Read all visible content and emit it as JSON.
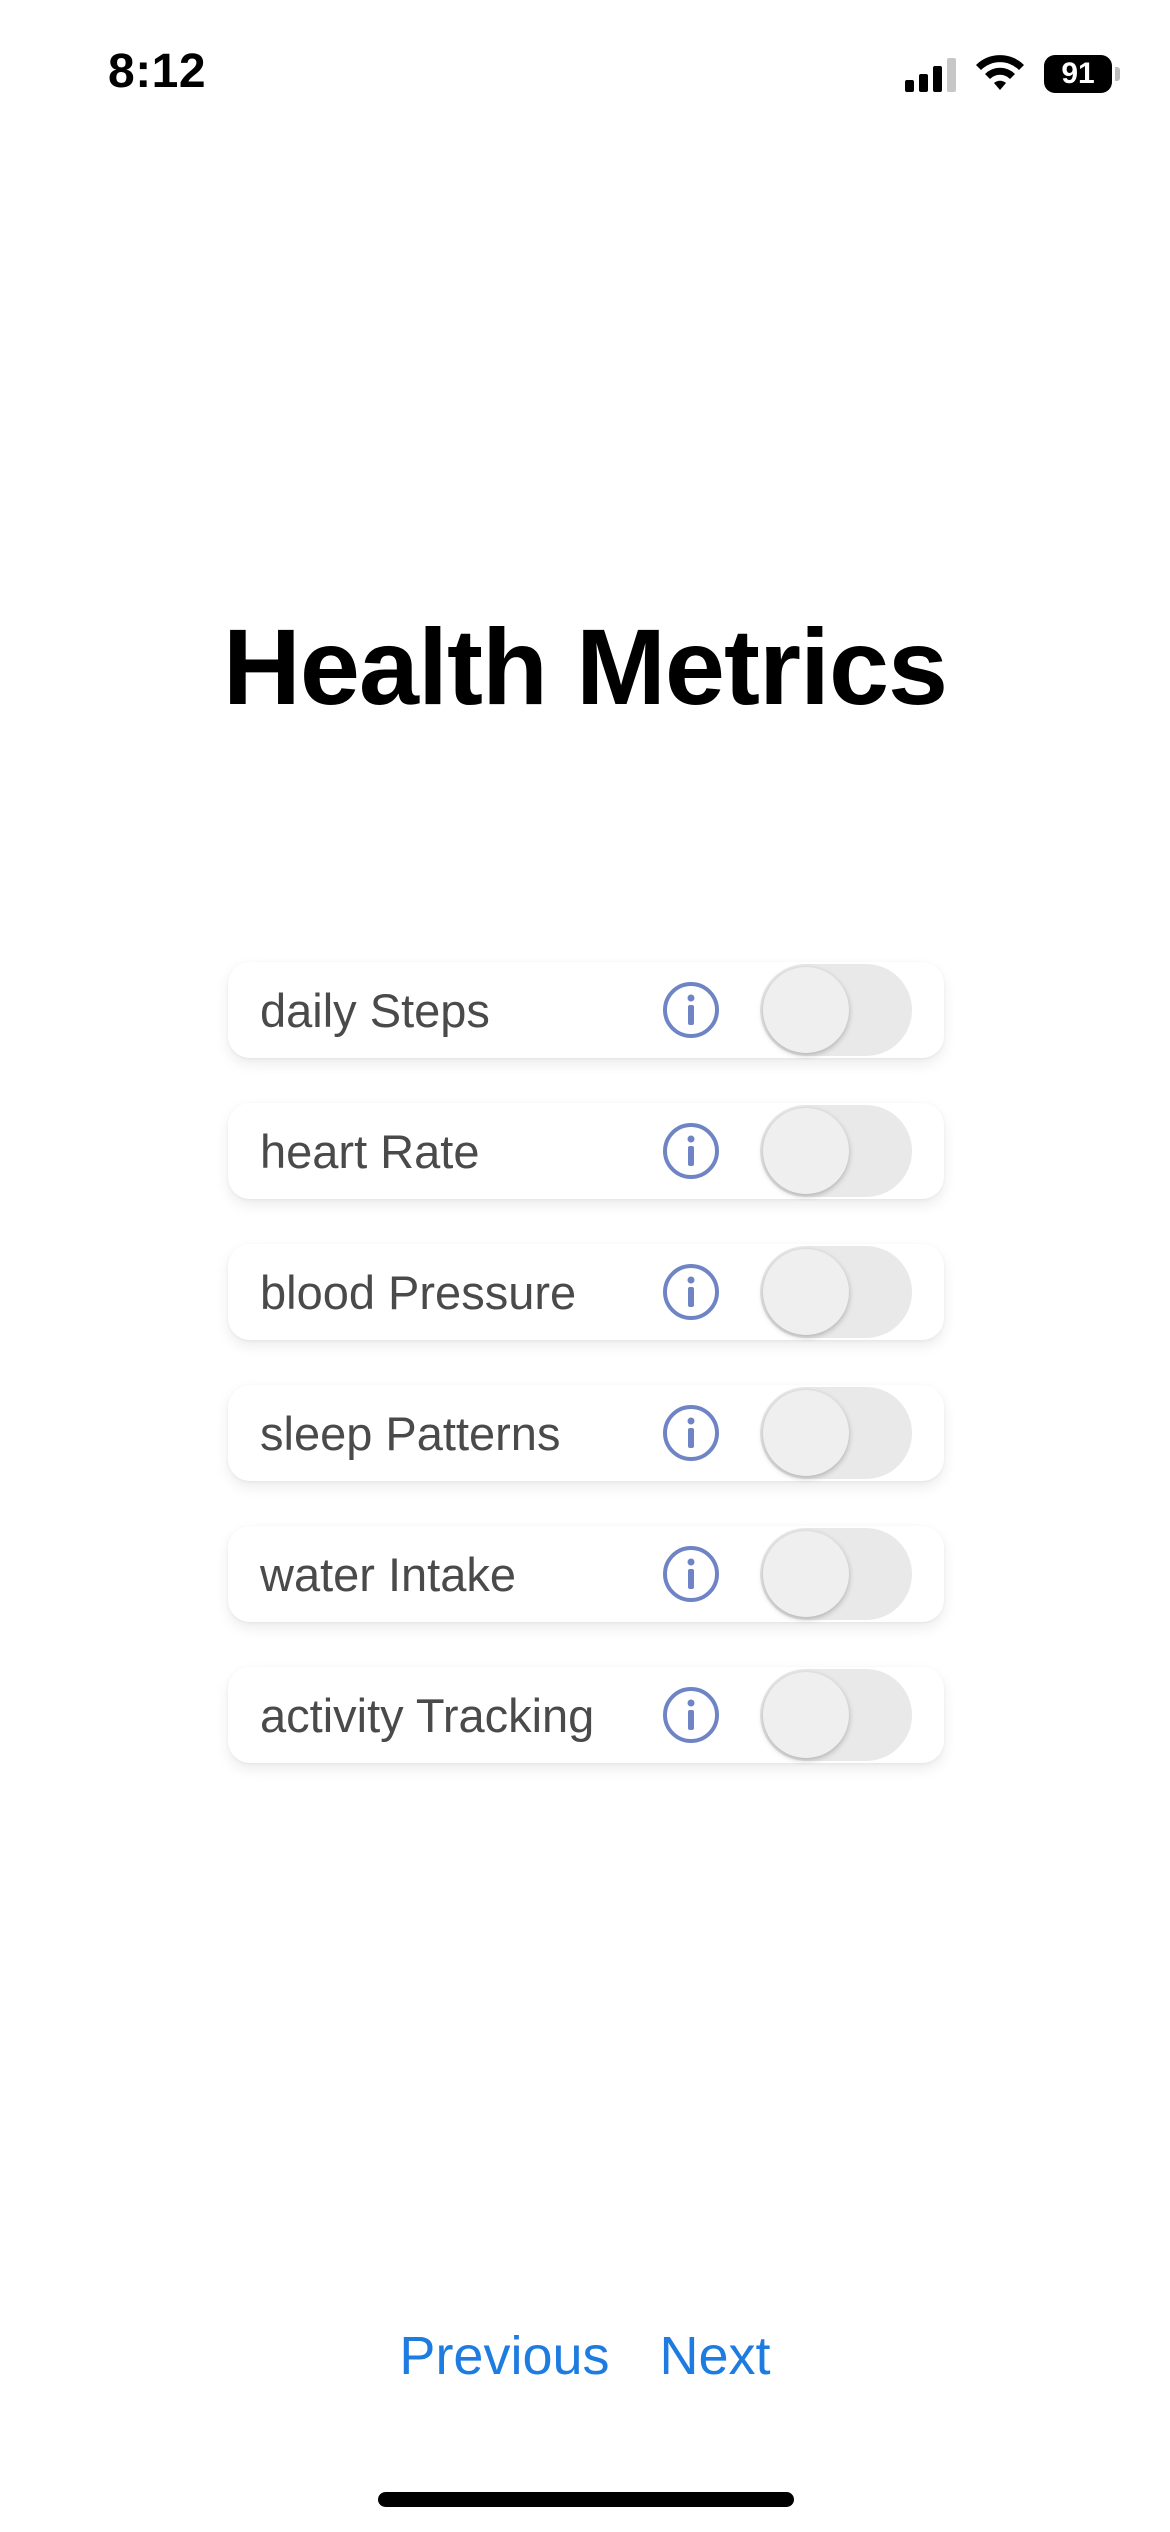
{
  "status_bar": {
    "time": "8:12",
    "battery_level": "91",
    "icons": [
      "signal-icon",
      "wifi-icon",
      "battery-icon"
    ]
  },
  "page": {
    "title": "Health Metrics"
  },
  "metrics": [
    {
      "label": "daily Steps",
      "enabled": false
    },
    {
      "label": "heart Rate",
      "enabled": false
    },
    {
      "label": "blood Pressure",
      "enabled": false
    },
    {
      "label": "sleep Patterns",
      "enabled": false
    },
    {
      "label": "water Intake",
      "enabled": false
    },
    {
      "label": "activity Tracking",
      "enabled": false
    }
  ],
  "navigation": {
    "previous_label": "Previous",
    "next_label": "Next"
  },
  "colors": {
    "accent": "#1e7ce0",
    "info_icon": "#6f84c4",
    "toggle_off": "#e9e9ea",
    "label_text": "#4a4a4a"
  }
}
